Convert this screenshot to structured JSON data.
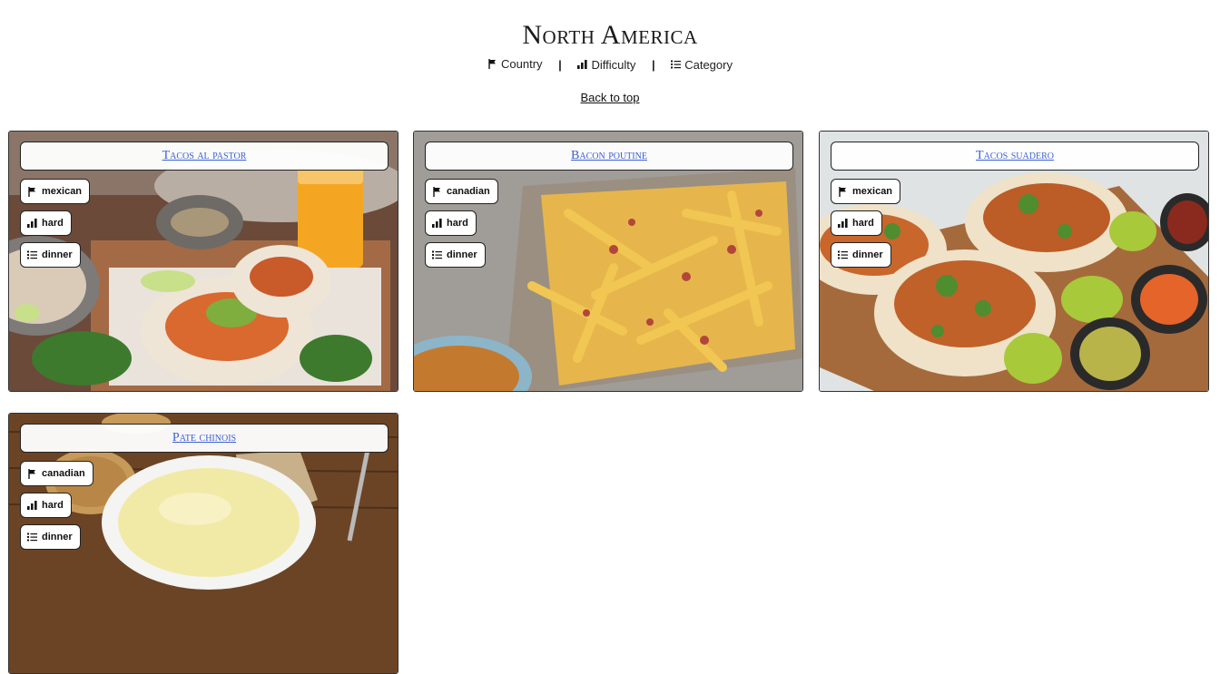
{
  "page": {
    "title": "North America",
    "back_to_top": "Back to top"
  },
  "filters": [
    {
      "icon": "flag-icon",
      "label": "Country"
    },
    {
      "icon": "bar-chart-icon",
      "label": "Difficulty"
    },
    {
      "icon": "list-icon",
      "label": "Category"
    }
  ],
  "filter_separator": "|",
  "recipes": [
    {
      "title": "Tacos al pastor",
      "country": "mexican",
      "difficulty": "hard",
      "category": "dinner"
    },
    {
      "title": "Bacon poutine",
      "country": "canadian",
      "difficulty": "hard",
      "category": "dinner"
    },
    {
      "title": "Tacos suadero",
      "country": "mexican",
      "difficulty": "hard",
      "category": "dinner"
    },
    {
      "title": "Pate chinois",
      "country": "canadian",
      "difficulty": "hard",
      "category": "dinner"
    }
  ],
  "colors": {
    "link": "#3b5fd6",
    "border": "#222222"
  }
}
